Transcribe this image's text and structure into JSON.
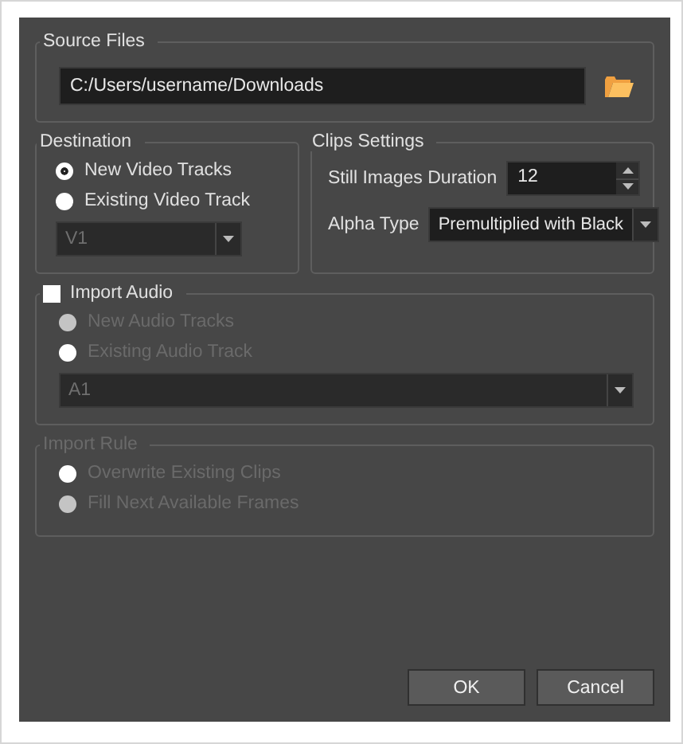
{
  "source_files": {
    "title": "Source Files",
    "path": "C:/Users/username/Downloads"
  },
  "destination": {
    "title": "Destination",
    "options": [
      {
        "label": "New Video Tracks",
        "selected": true
      },
      {
        "label": "Existing Video Track",
        "selected": false
      }
    ],
    "track": "V1",
    "disabled_track": true
  },
  "clips_settings": {
    "title": "Clips Settings",
    "duration_label": "Still Images Duration",
    "duration": "12",
    "alpha_label": "Alpha Type",
    "alpha": "Premultiplied with Black"
  },
  "import_audio": {
    "title": "Import Audio",
    "checked": false,
    "disabled": true,
    "options": [
      {
        "label": "New Audio Tracks",
        "selected": true
      },
      {
        "label": "Existing Audio Track",
        "selected": false
      }
    ],
    "track": "A1"
  },
  "import_rule": {
    "title": "Import Rule",
    "disabled": true,
    "options": [
      {
        "label": "Overwrite Existing Clips",
        "selected": false
      },
      {
        "label": "Fill Next Available Frames",
        "selected": true
      }
    ]
  },
  "buttons": [
    "OK",
    "Cancel"
  ]
}
